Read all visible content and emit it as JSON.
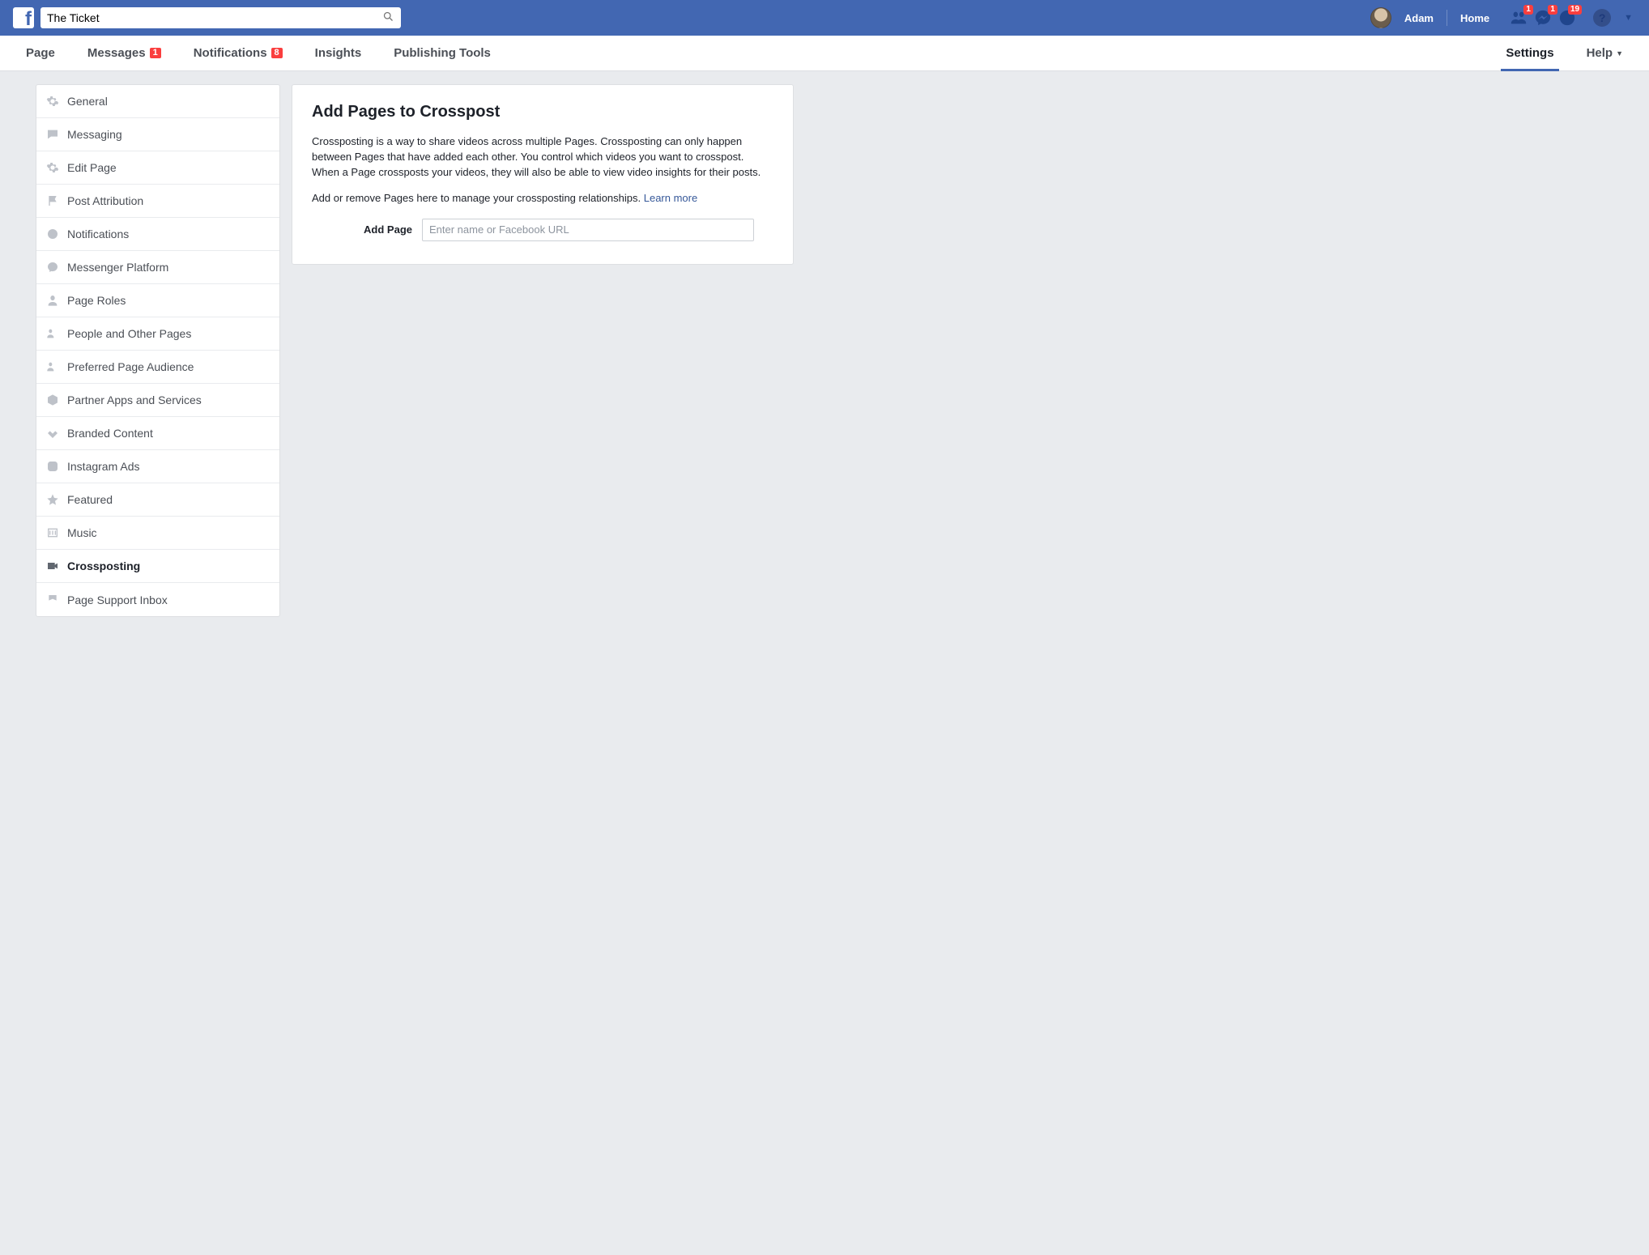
{
  "topbar": {
    "search_value": "The Ticket",
    "user_name": "Adam",
    "home_label": "Home",
    "badges": {
      "friends": "1",
      "messages": "1",
      "notifications": "19"
    }
  },
  "page_tabs": {
    "page": "Page",
    "messages": "Messages",
    "messages_badge": "1",
    "notifications": "Notifications",
    "notifications_badge": "8",
    "insights": "Insights",
    "publishing": "Publishing Tools",
    "settings": "Settings",
    "help": "Help"
  },
  "sidebar": {
    "items": [
      "General",
      "Messaging",
      "Edit Page",
      "Post Attribution",
      "Notifications",
      "Messenger Platform",
      "Page Roles",
      "People and Other Pages",
      "Preferred Page Audience",
      "Partner Apps and Services",
      "Branded Content",
      "Instagram Ads",
      "Featured",
      "Music",
      "Crossposting",
      "Page Support Inbox"
    ],
    "active_index": 14
  },
  "main": {
    "title": "Add Pages to Crosspost",
    "description": "Crossposting is a way to share videos across multiple Pages. Crossposting can only happen between Pages that have added each other. You control which videos you want to crosspost. When a Page crossposts your videos, they will also be able to view video insights for their posts.",
    "manage_text": "Add or remove Pages here to manage your crossposting relationships. ",
    "learn_more": "Learn more",
    "add_label": "Add Page",
    "add_placeholder": "Enter name or Facebook URL"
  }
}
